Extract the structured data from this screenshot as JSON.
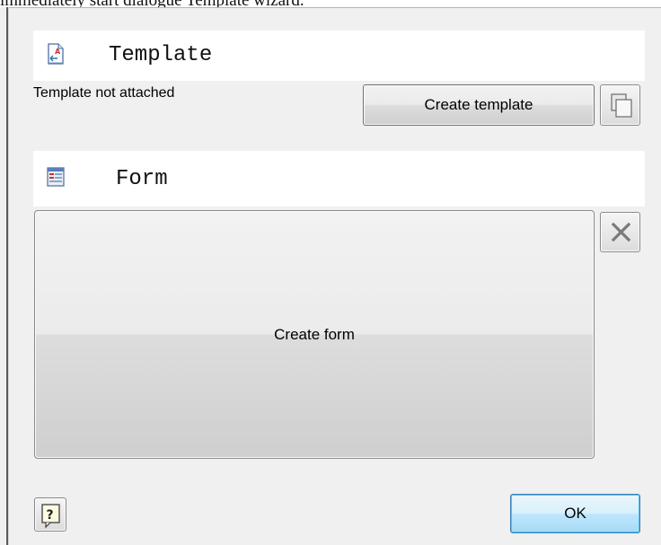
{
  "caption": {
    "text": "immediately start dialogue Template wizard."
  },
  "template_section": {
    "title": "Template",
    "icon": "template-doc-icon",
    "status": "Template not attached",
    "create_button_label": "Create template",
    "copy_button_icon": "copy-icon"
  },
  "form_section": {
    "title": "Form",
    "icon": "form-icon",
    "create_button_label": "Create form",
    "delete_button_icon": "close-icon"
  },
  "footer": {
    "help_icon": "help-icon",
    "ok_label": "OK"
  },
  "colors": {
    "dialog_background": "#f0f0f0",
    "header_background": "#ffffff",
    "ok_button_border": "#3c7fb1"
  }
}
